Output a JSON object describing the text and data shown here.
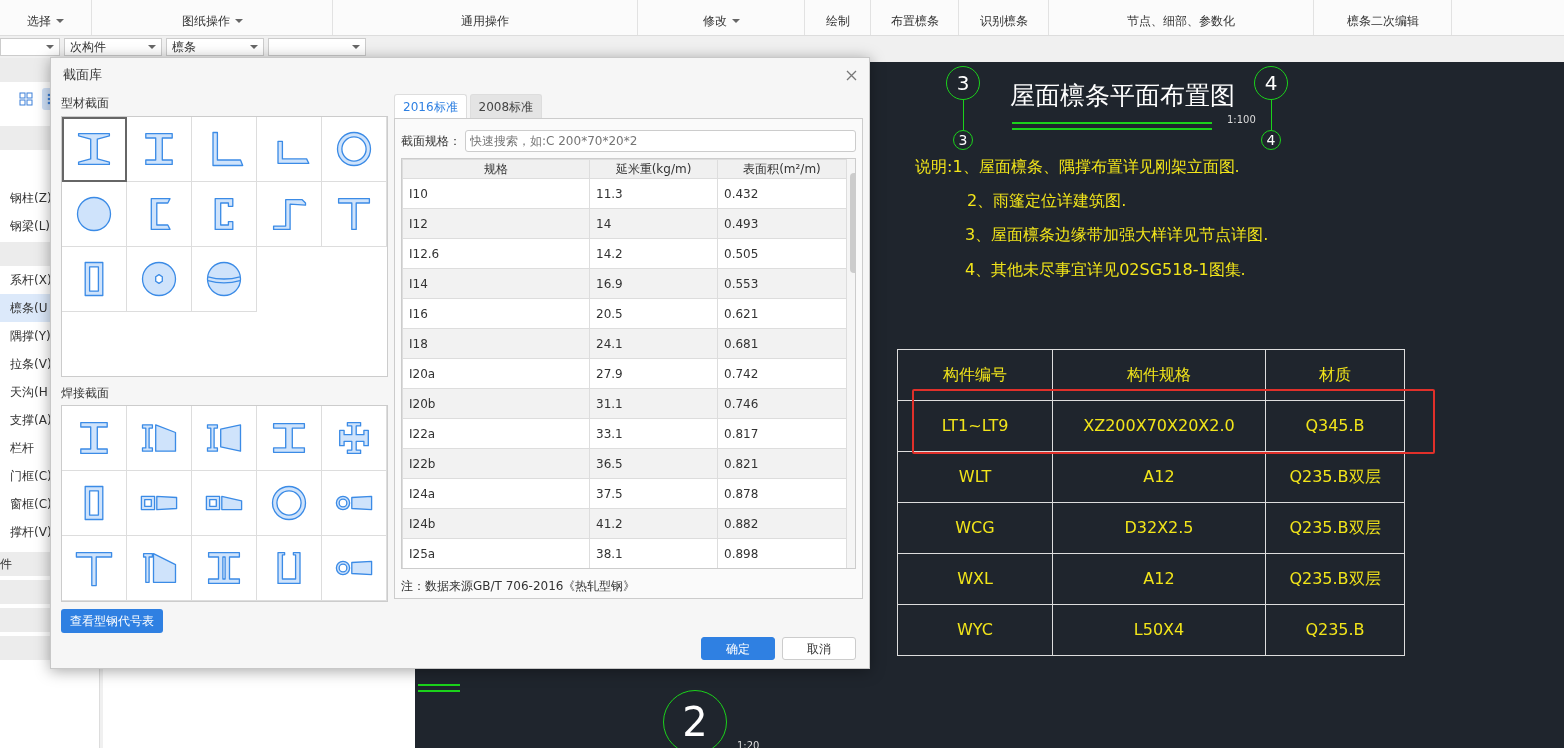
{
  "ribbon": {
    "groups": [
      {
        "label": "选择",
        "dropdown": true
      },
      {
        "label": "图纸操作",
        "dropdown": true
      },
      {
        "label": "通用操作",
        "dropdown": false
      },
      {
        "label": "修改",
        "dropdown": true
      },
      {
        "label": "绘制",
        "dropdown": false
      },
      {
        "label": "布置檩条",
        "dropdown": false
      },
      {
        "label": "识别檩条",
        "dropdown": false
      },
      {
        "label": "节点、细部、参数化",
        "dropdown": false
      },
      {
        "label": "檩条二次编辑",
        "dropdown": false
      }
    ]
  },
  "filter_dropdowns": [
    {
      "kind": "blank"
    },
    {
      "kind": "text",
      "value": "次构件"
    },
    {
      "kind": "text",
      "value": "檩条"
    },
    {
      "kind": "blank"
    }
  ],
  "sidebar": {
    "view_buttons": [
      {
        "selected": false
      },
      {
        "selected": true
      }
    ],
    "rows": [
      {
        "kind": "band"
      },
      {
        "kind": "item",
        "label": "钢柱(Z)",
        "selected": false
      },
      {
        "kind": "item",
        "label": "钢梁(L)",
        "selected": false
      },
      {
        "kind": "band"
      },
      {
        "kind": "item",
        "label": "系杆(X)",
        "selected": false
      },
      {
        "kind": "item",
        "label": "檩条(U",
        "selected": true
      },
      {
        "kind": "item",
        "label": "隅撑(Y)",
        "selected": false
      },
      {
        "kind": "item",
        "label": "拉条(V)",
        "selected": false
      },
      {
        "kind": "item",
        "label": "天沟(H",
        "selected": false
      },
      {
        "kind": "item",
        "label": "支撑(A)",
        "selected": false
      },
      {
        "kind": "item",
        "label": "栏杆",
        "selected": false
      },
      {
        "kind": "item",
        "label": "门框(C)",
        "selected": false
      },
      {
        "kind": "item",
        "label": "窗框(C)",
        "selected": false
      },
      {
        "kind": "item",
        "label": "撑杆(V)",
        "selected": false
      },
      {
        "kind": "band",
        "label": "件"
      },
      {
        "kind": "band"
      },
      {
        "kind": "band"
      },
      {
        "kind": "band"
      }
    ]
  },
  "dialog": {
    "title": "截面库",
    "profile_heading": "型材截面",
    "profile_sections": [
      {
        "selected": true
      },
      {
        "selected": false
      },
      {
        "selected": false
      },
      {
        "selected": false
      },
      {
        "selected": false
      },
      {
        "selected": false
      },
      {
        "selected": false
      },
      {
        "selected": false
      },
      {
        "selected": false
      },
      {
        "selected": false
      },
      {
        "selected": false
      },
      {
        "selected": false
      },
      {
        "selected": false
      }
    ],
    "welded_heading": "焊接截面",
    "welded_sections": [
      {
        "selected": false
      },
      {
        "selected": false
      },
      {
        "selected": false
      },
      {
        "selected": false
      },
      {
        "selected": false
      },
      {
        "selected": false
      },
      {
        "selected": false
      },
      {
        "selected": false
      },
      {
        "selected": false
      },
      {
        "selected": false
      },
      {
        "selected": false
      },
      {
        "selected": false
      },
      {
        "selected": false
      },
      {
        "selected": false
      },
      {
        "selected": false
      }
    ],
    "code_table_button": "查看型钢代号表",
    "tabs": [
      {
        "label": "2016标准",
        "selected": true
      },
      {
        "label": "2008标准",
        "selected": false
      }
    ],
    "search": {
      "label": "截面规格：",
      "placeholder": "快速搜索，如:C 200*70*20*2"
    },
    "table": {
      "columns": [
        "规格",
        "延米重(kg/m)",
        "表面积(m²/m)"
      ],
      "rows": [
        [
          "I10",
          "11.3",
          "0.432"
        ],
        [
          "I12",
          "14",
          "0.493"
        ],
        [
          "I12.6",
          "14.2",
          "0.505"
        ],
        [
          "I14",
          "16.9",
          "0.553"
        ],
        [
          "I16",
          "20.5",
          "0.621"
        ],
        [
          "I18",
          "24.1",
          "0.681"
        ],
        [
          "I20a",
          "27.9",
          "0.742"
        ],
        [
          "I20b",
          "31.1",
          "0.746"
        ],
        [
          "I22a",
          "33.1",
          "0.817"
        ],
        [
          "I22b",
          "36.5",
          "0.821"
        ],
        [
          "I24a",
          "37.5",
          "0.878"
        ],
        [
          "I24b",
          "41.2",
          "0.882"
        ],
        [
          "I25a",
          "38.1",
          "0.898"
        ]
      ]
    },
    "note": "注：数据来源GB/T 706-2016《热轧型钢》",
    "buttons": [
      {
        "label": "确定",
        "kind": "primary"
      },
      {
        "label": "取消",
        "kind": "secondary"
      }
    ]
  },
  "drawing": {
    "title": "屋面檩条平面布置图",
    "scale": "1:100",
    "axes": [
      {
        "label": "3",
        "tag": "3"
      },
      {
        "label": "4",
        "tag": "4"
      }
    ],
    "notes": [
      "说明:1、屋面檩条、隅撑布置详见刚架立面图.",
      "2、雨篷定位详建筑图.",
      "3、屋面檩条边缘带加强大样详见节点详图.",
      "4、其他未尽事宜详见02SG518-1图集."
    ],
    "table": {
      "columns": [
        "构件编号",
        "构件规格",
        "材质"
      ],
      "rows": [
        {
          "cells": [
            "LT1~LT9",
            "XZ200X70X20X2.0",
            "Q345.B"
          ],
          "highlighted": true
        },
        {
          "cells": [
            "WLT",
            "A12",
            "Q235.B双层"
          ],
          "highlighted": false
        },
        {
          "cells": [
            "WCG",
            "D32X2.5",
            "Q235.B双层"
          ],
          "highlighted": false
        },
        {
          "cells": [
            "WXL",
            "A12",
            "Q235.B双层"
          ],
          "highlighted": false
        },
        {
          "cells": [
            "WYC",
            "L50X4",
            "Q235.B"
          ],
          "highlighted": false
        }
      ]
    },
    "detail_bubble": {
      "label": "2",
      "scale": "1:20"
    }
  }
}
